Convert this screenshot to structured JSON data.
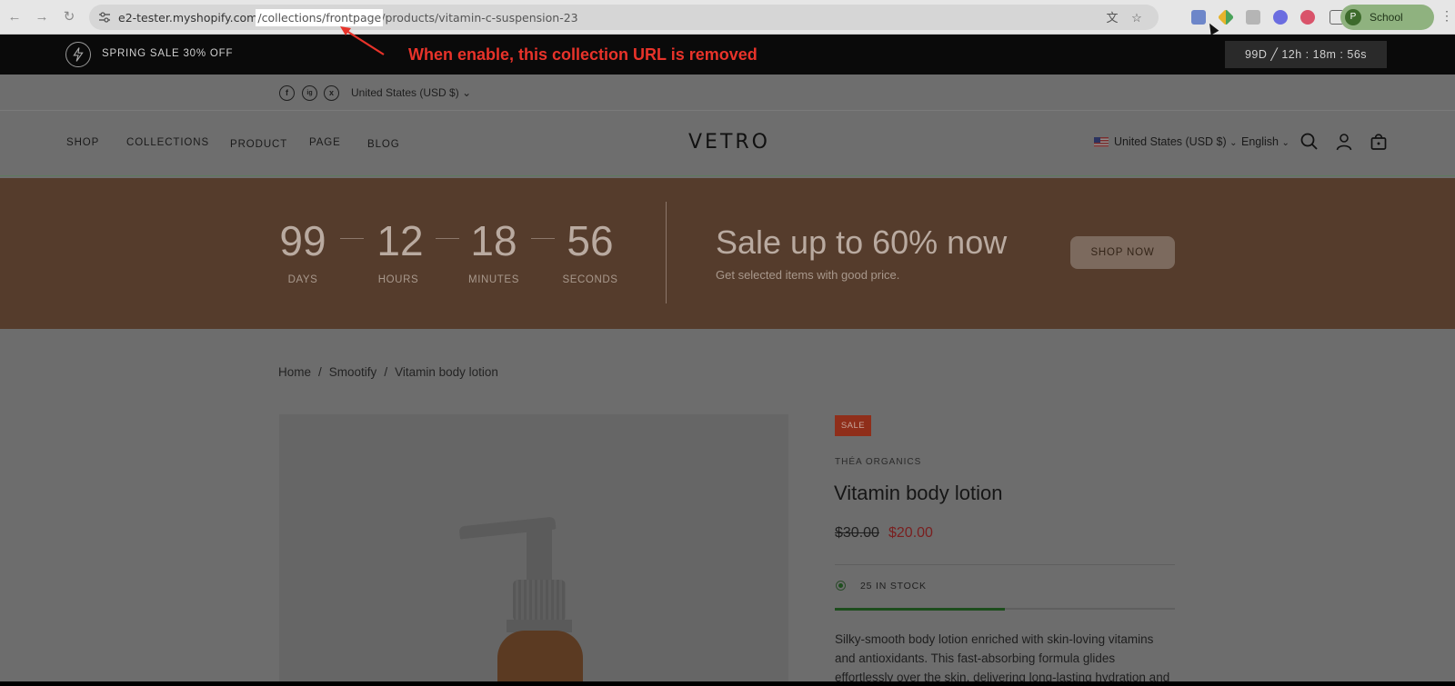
{
  "browser": {
    "url_host": "e2-tester.myshopify.com",
    "url_highlight": "/collections/frontpage",
    "url_rest": "/products/vitamin-c-suspension-23",
    "profile_initial": "P",
    "profile_name": "School",
    "profile_color": "#8fb27f"
  },
  "annotation": {
    "text": "When enable, this collection URL is removed",
    "color": "#e8332a"
  },
  "announcement": {
    "text": "SPRING SALE 30% OFF",
    "timer": "99D ╱ 12h : 18m : 56s"
  },
  "utility": {
    "social": [
      "f",
      "ig",
      "x"
    ],
    "currency": "United States (USD $)"
  },
  "header": {
    "menu": [
      "SHOP",
      "COLLECTIONS",
      "PRODUCT",
      "PAGE",
      "BLOG"
    ],
    "logo": "VETRO",
    "currency": "United States (USD $)",
    "language": "English"
  },
  "promo": {
    "countdown": [
      {
        "value": "99",
        "label": "DAYS"
      },
      {
        "value": "12",
        "label": "HOURS"
      },
      {
        "value": "18",
        "label": "MINUTES"
      },
      {
        "value": "56",
        "label": "SECONDS"
      }
    ],
    "title": "Sale up to 60% now",
    "subtitle": "Get selected items with good price.",
    "button": "SHOP NOW",
    "background": "#553c2c"
  },
  "breadcrumb": [
    "Home",
    "Smootify",
    "Vitamin body lotion"
  ],
  "product": {
    "badge": "SALE",
    "vendor": "THÉA ORGANICS",
    "title": "Vitamin body lotion",
    "price_old": "$30.00",
    "price_new": "$20.00",
    "stock_text": "25 IN STOCK",
    "stock_level": 0.5,
    "description": "Silky-smooth body lotion enriched with skin-loving vitamins and antioxidants. This fast-absorbing formula glides effortlessly over the skin, delivering long-lasting hydration and"
  }
}
